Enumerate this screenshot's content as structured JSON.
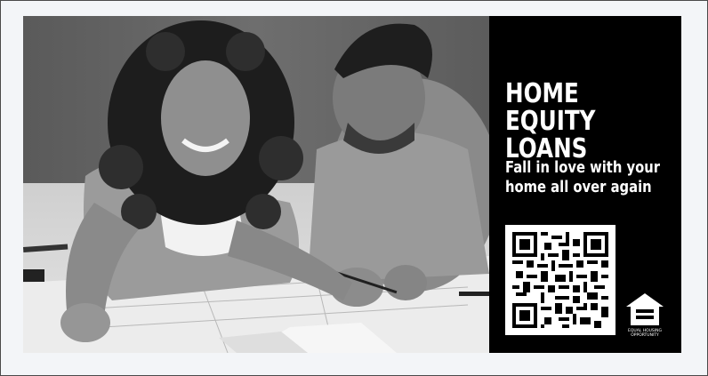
{
  "ad": {
    "headline": "HOME EQUITY LOANS",
    "tagline": "Fall in love with your home all over again",
    "qr_code": "qr-code",
    "equal_housing_label": "EQUAL HOUSING OPPORTUNITY",
    "colors": {
      "panel_background": "#000000",
      "panel_text": "#ffffff",
      "qr_background": "#ffffff"
    }
  }
}
